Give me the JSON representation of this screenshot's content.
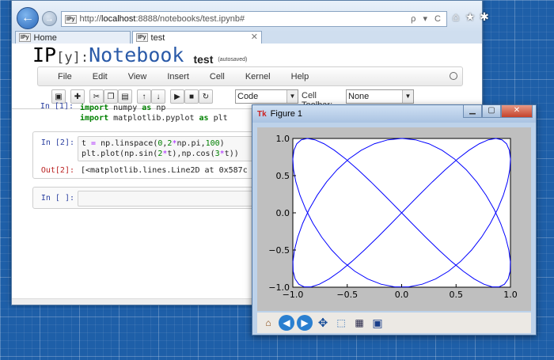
{
  "browser": {
    "address_prefix": "http://",
    "address_host": "localhost",
    "address_path": ":8888/notebooks/test.ipynb#",
    "address_actions": "ρ ▾ C",
    "favicon": "IPy",
    "tabs": [
      {
        "label": "Home",
        "favicon": "IPy"
      },
      {
        "label": "test",
        "favicon": "IPy",
        "active": true
      }
    ],
    "toolbar_icons": [
      "home-icon",
      "star-icon",
      "gear-icon"
    ]
  },
  "notebook": {
    "logo_ip": "IP",
    "logo_y": "[y]:",
    "logo_notebook": "Notebook",
    "title": "test",
    "autosave": "(autosaved)",
    "menu": [
      "File",
      "Edit",
      "View",
      "Insert",
      "Cell",
      "Kernel",
      "Help"
    ],
    "cell_type": "Code",
    "cell_toolbar_label": "Cell Toolbar:",
    "cell_toolbar_value": "None",
    "toolbar_buttons": [
      "save-icon",
      "insert-cell-icon",
      "cut-icon",
      "copy-icon",
      "paste-icon",
      "move-up-icon",
      "move-down-icon",
      "run-icon",
      "stop-icon",
      "restart-icon"
    ]
  },
  "cells": [
    {
      "prompt": "In [1]:",
      "lines": [
        "import numpy as np",
        "import matplotlib.pyplot as plt"
      ]
    },
    {
      "prompt": "In [2]:",
      "lines": [
        "t = np.linspace(0,2*np.pi,100)",
        "plt.plot(np.sin(2*t),np.cos(3*t))"
      ]
    },
    {
      "prompt": "Out[2]:",
      "output": "[<matplotlib.lines.Line2D at 0x587c"
    },
    {
      "prompt": "In [ ]:",
      "lines": [
        ""
      ]
    }
  ],
  "figure": {
    "title": "Figure 1",
    "app_icon": "Tk",
    "toolbar": [
      "home-icon",
      "back-icon",
      "forward-icon",
      "pan-icon",
      "zoom-icon",
      "subplots-icon",
      "save-icon"
    ]
  },
  "chart_data": {
    "type": "line",
    "series": [
      {
        "expr_x": "sin(2t)",
        "expr_y": "cos(3t)",
        "t_range": [
          0,
          6.2832
        ],
        "points": 100,
        "color": "#0000ff"
      }
    ],
    "xlim": [
      -1.0,
      1.0
    ],
    "ylim": [
      -1.0,
      1.0
    ],
    "xticks": [
      "−1.0",
      "−0.5",
      "0.0",
      "0.5",
      "1.0"
    ],
    "yticks": [
      "1.0",
      "0.5",
      "0.0",
      "−0.5",
      "−1.0"
    ],
    "title": "",
    "xlabel": "",
    "ylabel": "",
    "grid": false
  }
}
